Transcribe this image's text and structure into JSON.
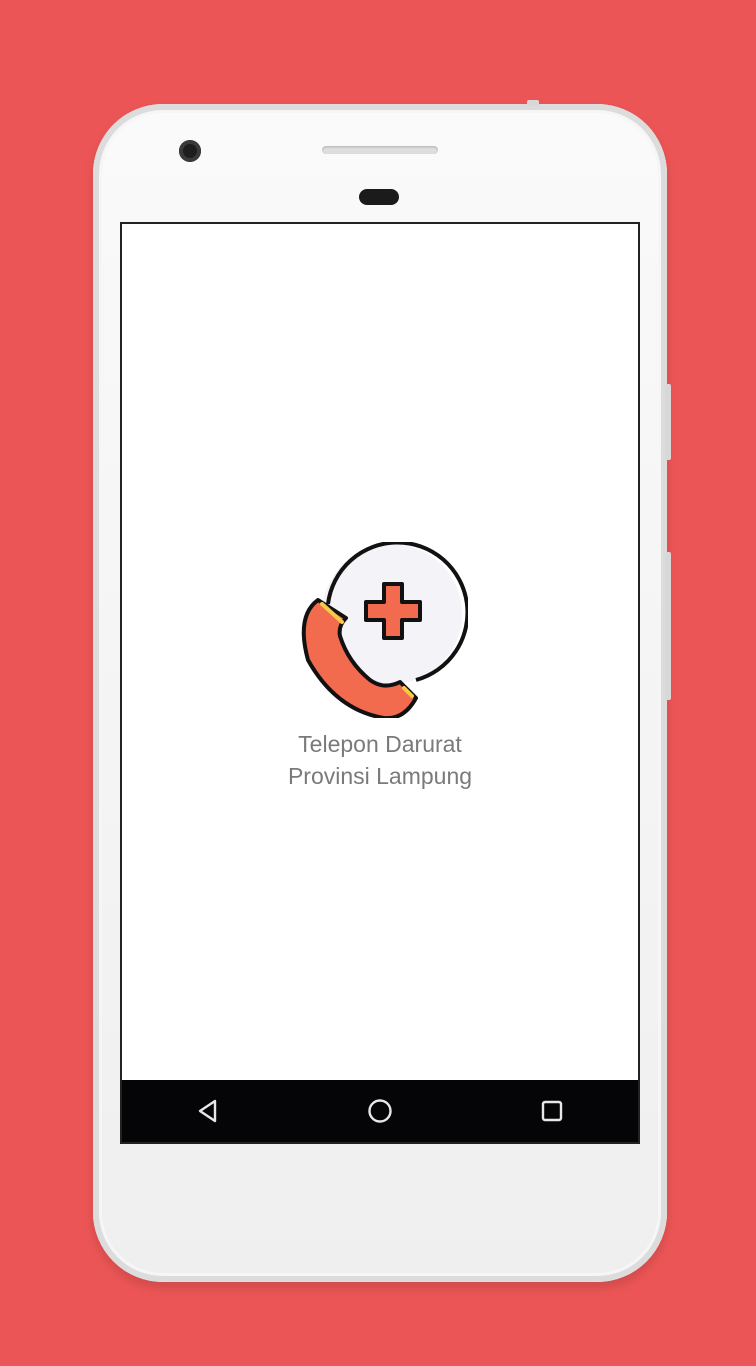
{
  "splash": {
    "title_line1": "Telepon Darurat",
    "title_line2": "Provinsi Lampung",
    "logo_icon": "emergency-call-icon"
  },
  "navbar": {
    "back_icon": "back-icon",
    "home_icon": "home-icon",
    "recents_icon": "recents-icon"
  },
  "colors": {
    "background": "#ec5555",
    "accent_orange": "#f26b4f",
    "text_gray": "#7a7a7a",
    "navbar": "#050507"
  }
}
